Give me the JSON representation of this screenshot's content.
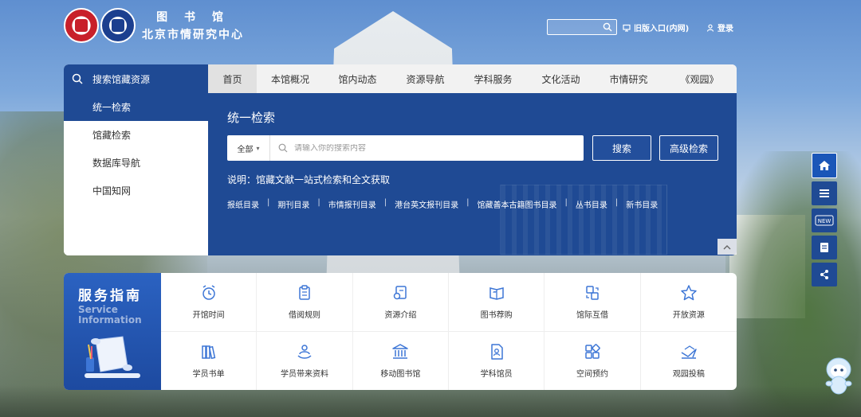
{
  "header": {
    "logo_line1": "图 书 馆",
    "logo_line2": "北京市情研究中心",
    "search": {
      "placeholder": ""
    },
    "old_portal": "旧版入口(内网)",
    "login": "登录"
  },
  "side_panel": {
    "title": "搜索馆藏资源",
    "items": [
      {
        "label": "统一检索"
      },
      {
        "label": "馆藏检索"
      },
      {
        "label": "数据库导航"
      },
      {
        "label": "中国知网"
      }
    ]
  },
  "nav": {
    "tabs": [
      {
        "label": "首页"
      },
      {
        "label": "本馆概况"
      },
      {
        "label": "馆内动态"
      },
      {
        "label": "资源导航"
      },
      {
        "label": "学科服务"
      },
      {
        "label": "文化活动"
      },
      {
        "label": "市情研究"
      },
      {
        "label": "《观园》"
      }
    ]
  },
  "search_main": {
    "title": "统一检索",
    "scope": "全部",
    "placeholder": "请输入你的搜索内容",
    "search_button": "搜索",
    "advanced_button": "高级检索",
    "note": "说明：馆藏文献一站式检索和全文获取",
    "links": [
      {
        "label": "报纸目录"
      },
      {
        "label": "期刊目录"
      },
      {
        "label": "市情报刊目录"
      },
      {
        "label": "港台英文报刊目录"
      },
      {
        "label": "馆藏善本古籍图书目录"
      },
      {
        "label": "丛书目录"
      },
      {
        "label": "新书目录"
      }
    ]
  },
  "service_guide": {
    "title": "服务指南",
    "subtitle_line1": "Service",
    "subtitle_line2": "Information",
    "items": [
      {
        "label": "开馆时间",
        "icon": "alarm-clock-icon"
      },
      {
        "label": "借阅规则",
        "icon": "clipboard-icon"
      },
      {
        "label": "资源介绍",
        "icon": "resource-icon"
      },
      {
        "label": "图书荐购",
        "icon": "book-heart-icon"
      },
      {
        "label": "馆际互借",
        "icon": "exchange-icon"
      },
      {
        "label": "开放资源",
        "icon": "star-icon"
      },
      {
        "label": "学员书单",
        "icon": "books-icon"
      },
      {
        "label": "学员带来资料",
        "icon": "person-hand-icon"
      },
      {
        "label": "移动图书馆",
        "icon": "library-building-icon"
      },
      {
        "label": "学科馆员",
        "icon": "doc-person-icon"
      },
      {
        "label": "空间预约",
        "icon": "grid-squares-icon"
      },
      {
        "label": "观园投稿",
        "icon": "send-letter-icon"
      }
    ]
  },
  "float_toolbar": {
    "items": [
      {
        "icon": "home-icon"
      },
      {
        "icon": "stack-icon"
      },
      {
        "icon": "new-icon",
        "label": "NEW"
      },
      {
        "icon": "document-icon"
      },
      {
        "icon": "share-icon"
      }
    ]
  },
  "colors": {
    "primary": "#1f4a94",
    "accent": "#2b62c1"
  }
}
